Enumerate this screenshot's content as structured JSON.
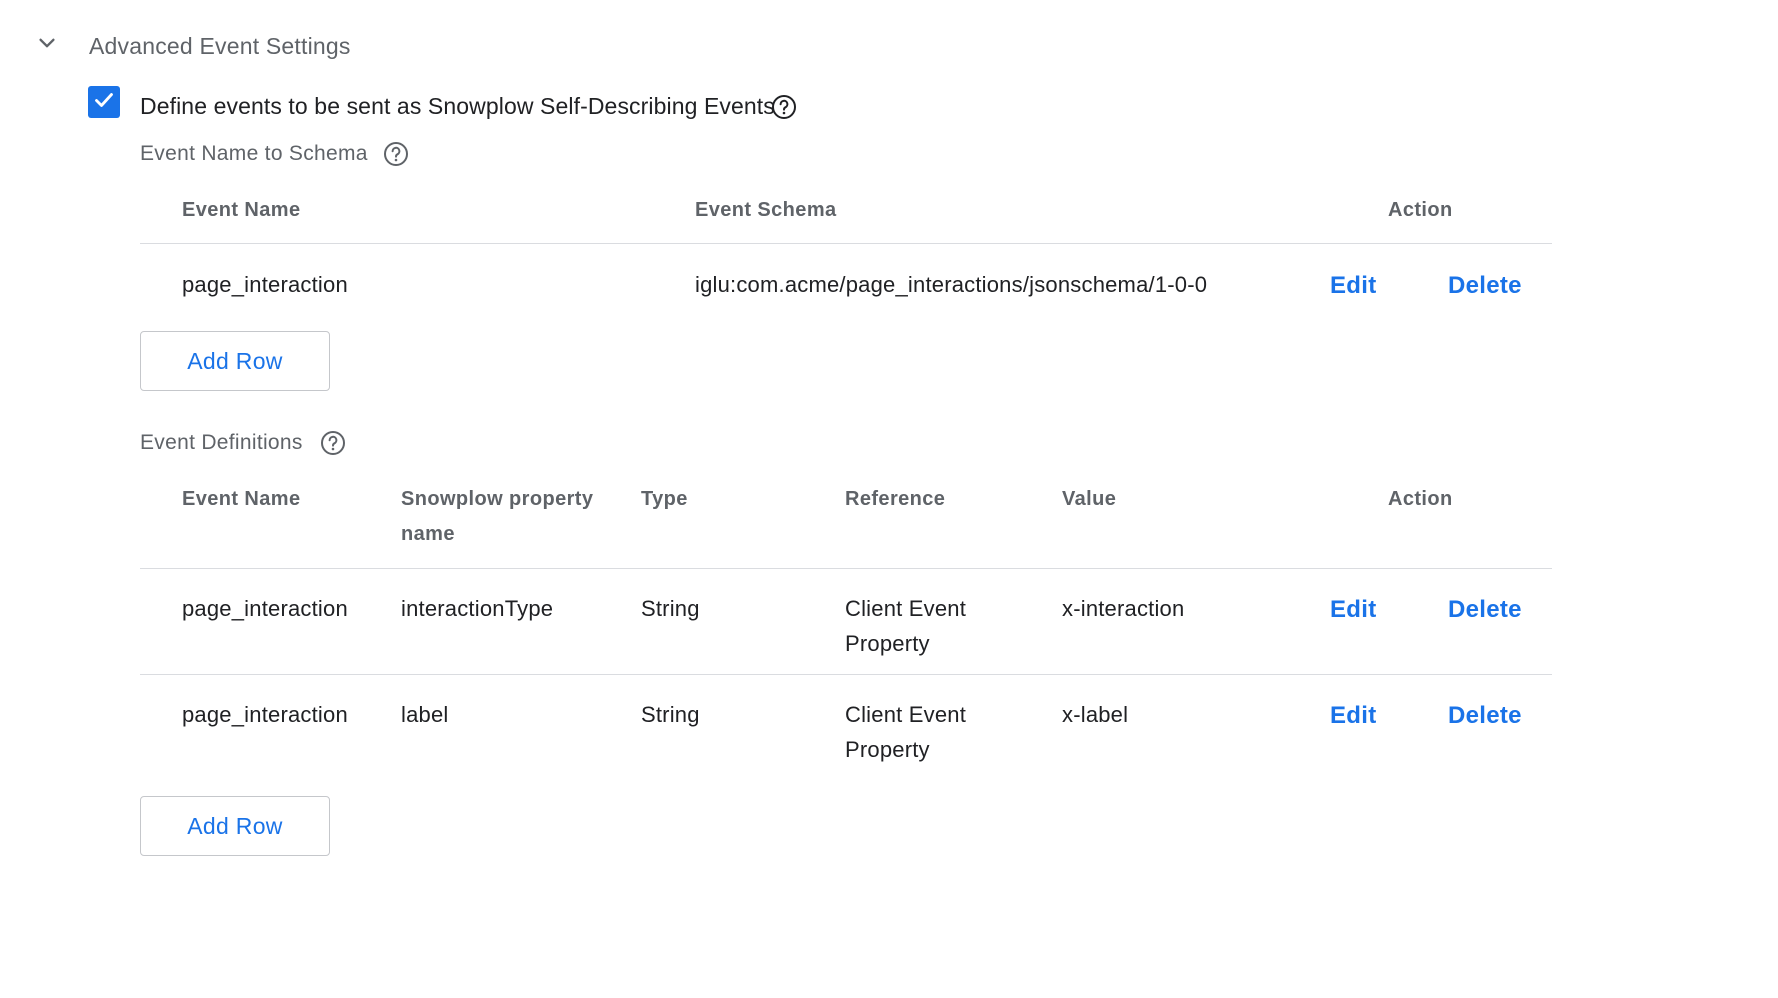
{
  "section": {
    "title": "Advanced Event Settings",
    "expanded": true
  },
  "self_describing": {
    "label": "Define events to be sent as Snowplow Self-Describing Events",
    "checked": true
  },
  "schema_table": {
    "label": "Event Name to Schema",
    "headers": {
      "event_name": "Event Name",
      "event_schema": "Event Schema",
      "action": "Action"
    },
    "rows": [
      {
        "event_name": "page_interaction",
        "event_schema": "iglu:com.acme/page_interactions/jsonschema/1-0-0",
        "edit": "Edit",
        "delete": "Delete"
      }
    ],
    "add_row": "Add Row"
  },
  "definitions_table": {
    "label": "Event Definitions",
    "headers": {
      "event_name": "Event Name",
      "property_line1": "Snowplow property",
      "property_line2": "name",
      "type": "Type",
      "reference": "Reference",
      "value": "Value",
      "action": "Action"
    },
    "rows": [
      {
        "event_name": "page_interaction",
        "property": "interactionType",
        "type": "String",
        "reference_line1": "Client Event",
        "reference_line2": "Property",
        "value": "x-interaction",
        "edit": "Edit",
        "delete": "Delete"
      },
      {
        "event_name": "page_interaction",
        "property": "label",
        "type": "String",
        "reference_line1": "Client Event",
        "reference_line2": "Property",
        "value": "x-label",
        "edit": "Edit",
        "delete": "Delete"
      }
    ],
    "add_row": "Add Row"
  },
  "colors": {
    "accent": "#1a73e8",
    "secondary_text": "#5f6368",
    "primary_text": "#202124",
    "divider": "#dadce0"
  },
  "icons": {
    "collapse": "chevron-down-icon",
    "checkbox": "check-icon",
    "help": "help-circle-icon"
  }
}
